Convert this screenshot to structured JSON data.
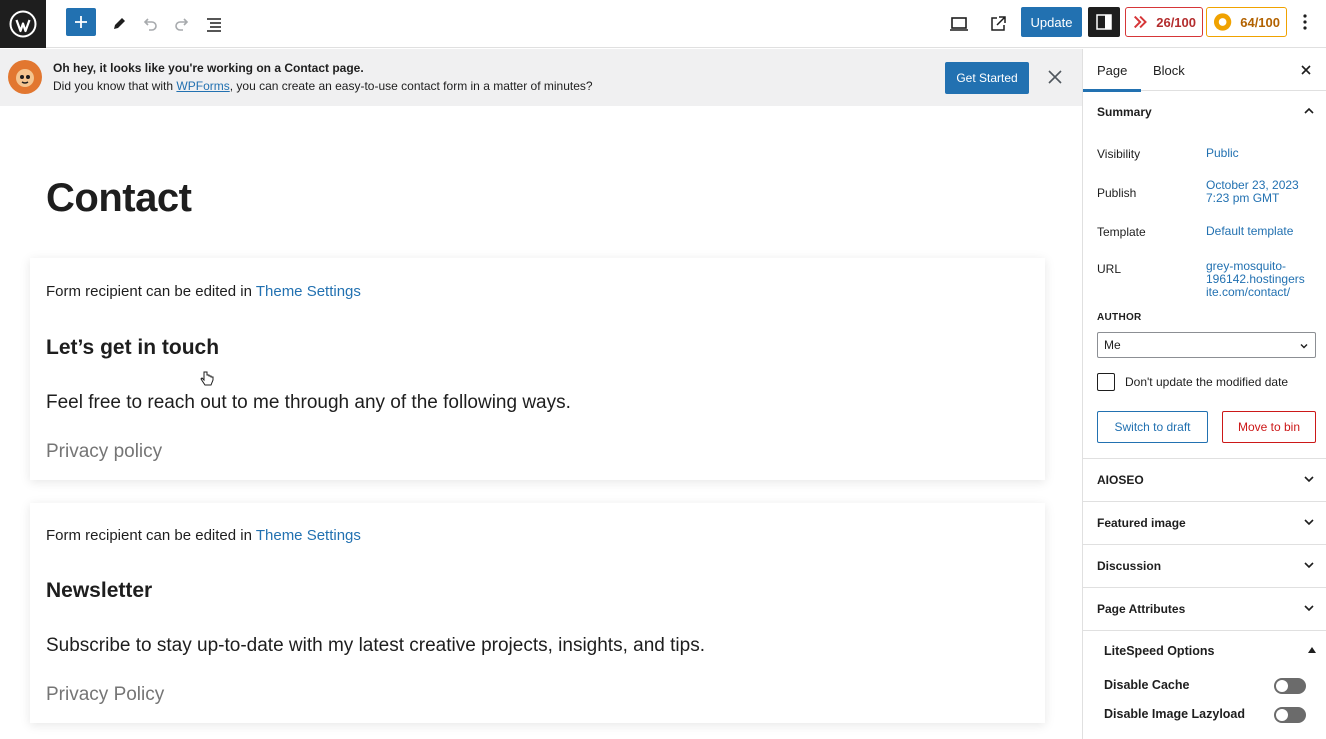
{
  "toolbar": {
    "update_label": "Update",
    "score_a": "26/100",
    "score_b": "64/100"
  },
  "notice": {
    "title": "Oh hey, it looks like you're working on a Contact page.",
    "text_prefix": "Did you know that with ",
    "link": "WPForms",
    "text_suffix": ", you can create an easy-to-use contact form in a matter of minutes?",
    "button": "Get Started"
  },
  "editor": {
    "title": "Contact",
    "blocks": [
      {
        "recipient_prefix": "Form recipient can be edited in ",
        "recipient_link": "Theme Settings",
        "heading": "Let’s get in touch",
        "body": "Feel free to reach out to me through any of the following ways.",
        "muted": "Privacy policy"
      },
      {
        "recipient_prefix": "Form recipient can be edited in ",
        "recipient_link": "Theme Settings",
        "heading": "Newsletter",
        "body": "Subscribe to stay up-to-date with my latest creative projects, insights, and tips.",
        "muted": "Privacy Policy"
      }
    ]
  },
  "sidebar": {
    "tabs": [
      "Page",
      "Block"
    ],
    "summary": {
      "title": "Summary",
      "visibility_label": "Visibility",
      "visibility_value": "Public",
      "publish_label": "Publish",
      "publish_value_line1": "October 23, 2023",
      "publish_value_line2": "7:23 pm GMT",
      "template_label": "Template",
      "template_value": "Default template",
      "url_label": "URL",
      "url_line1": "grey-mosquito-",
      "url_line2": "196142.hostingers",
      "url_line3": "ite.com/contact/",
      "author_label": "AUTHOR",
      "author_value": "Me",
      "checkbox_label": "Don't update the modified date",
      "draft_button": "Switch to draft",
      "bin_button": "Move to bin"
    },
    "panels": [
      "AIOSEO",
      "Featured image",
      "Discussion",
      "Page Attributes"
    ],
    "litespeed": {
      "title": "LiteSpeed Options",
      "options": [
        "Disable Cache",
        "Disable Image Lazyload"
      ]
    }
  }
}
